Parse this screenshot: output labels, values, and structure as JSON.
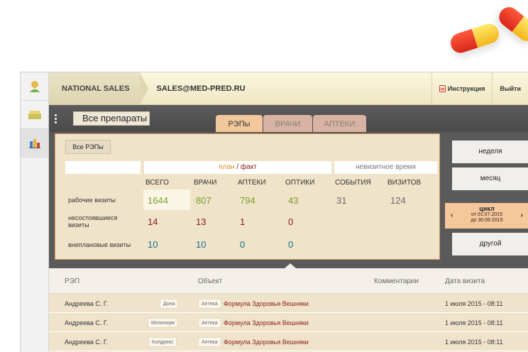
{
  "header": {
    "breadcrumb": "NATIONAL SALES",
    "email": "SALES@MED-PRED.RU",
    "instructions_label": "Инструкция",
    "logout_label": "Выйти"
  },
  "toolbar": {
    "drug_filter": "Все препараты",
    "tabs": [
      "РЭПы",
      "ВРАЧИ",
      "АПТЕКИ"
    ],
    "active_tab": "РЭПы"
  },
  "stats": {
    "filter_label": "Все РЭПы",
    "plan_label": "план",
    "slash": " / ",
    "fact_label": "факт",
    "nonvisit_label": "невизитное время",
    "columns": [
      "ВСЕГО",
      "ВРАЧИ",
      "АПТЕКИ",
      "ОПТИКИ",
      "СОБЫТИЯ",
      "ВИЗИТОВ"
    ],
    "rows": [
      {
        "label": "рабочие визиты",
        "values": [
          "1644",
          "807",
          "794",
          "43",
          "31",
          "124"
        ]
      },
      {
        "label": "несостоявшиеся визиты",
        "values": [
          "14",
          "13",
          "1",
          "0"
        ]
      },
      {
        "label": "внеплановые визиты",
        "values": [
          "10",
          "10",
          "0",
          "0"
        ]
      }
    ],
    "colors": {
      "green": "#7c9d2c",
      "red": "#8b1c1c",
      "blue": "#1e6f93",
      "gray": "#6a6a6a"
    }
  },
  "periods": {
    "week": "неделя",
    "month": "месяц",
    "cycle_title": "цикл",
    "cycle_from": "от 01.07.2015",
    "cycle_to": "до 30.09.2015",
    "other": "другой"
  },
  "table": {
    "columns": {
      "rep": "РЭП",
      "object": "Объект",
      "comments": "Комментарии",
      "date": "Дата визита"
    },
    "rows": [
      {
        "rep": "Андреева С. Г.",
        "drug": "Дона",
        "type": "Аптека",
        "object": "Формула Здоровья Вешняки",
        "date": "1 июля 2015 - 08:11"
      },
      {
        "rep": "Андреева С. Г.",
        "drug": "Мотилиум",
        "type": "Аптека",
        "object": "Формула Здоровья Вешняки",
        "date": "1 июля 2015 - 08:11"
      },
      {
        "rep": "Андреева С. Г.",
        "drug": "Колдрекс",
        "type": "Аптека",
        "object": "Формула Здоровья Вешняки",
        "date": "1 июля 2015 - 08:11"
      }
    ]
  }
}
